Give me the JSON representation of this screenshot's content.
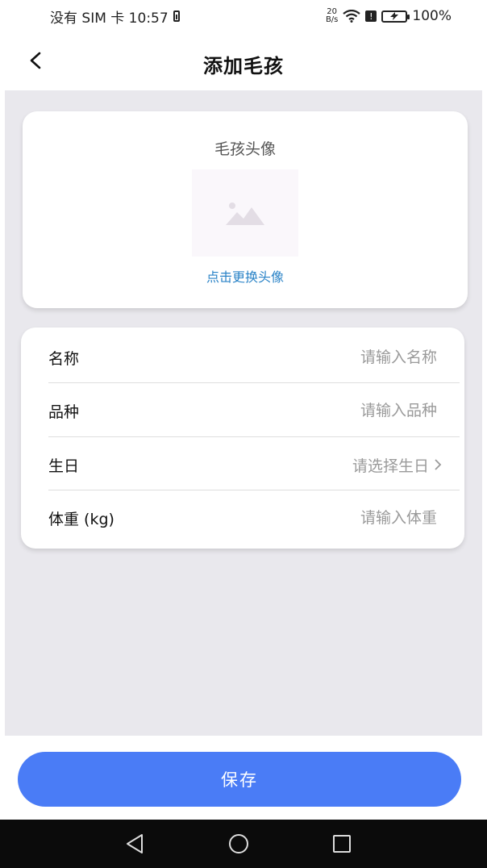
{
  "status_bar": {
    "carrier_time": "没有 SIM 卡 10:57",
    "net_speed_value": "20",
    "net_speed_unit": "B/s",
    "battery_percent": "100%"
  },
  "header": {
    "title": "添加毛孩"
  },
  "avatar_card": {
    "label": "毛孩头像",
    "change_text": "点击更换头像",
    "placeholder_icon": "image-icon"
  },
  "form": {
    "name": {
      "label": "名称",
      "placeholder": "请输入名称"
    },
    "breed": {
      "label": "品种",
      "placeholder": "请输入品种"
    },
    "birthday": {
      "label": "生日",
      "placeholder": "请选择生日"
    },
    "weight": {
      "label": "体重 (kg)",
      "placeholder": "请输入体重"
    }
  },
  "actions": {
    "save_label": "保存"
  },
  "colors": {
    "accent": "#4a7cf6",
    "link": "#2a83c7",
    "background": "#e9e8ed"
  }
}
